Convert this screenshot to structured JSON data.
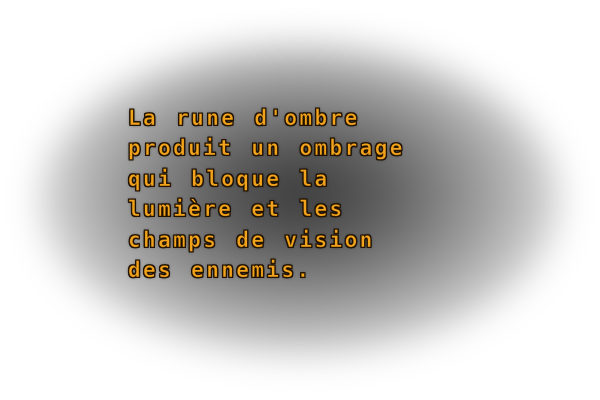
{
  "tooltip": {
    "lines": [
      "La rune d'ombre",
      "produit un ombrage",
      "qui bloque la",
      "lumière et les",
      "champs de vision",
      "des ennemis."
    ],
    "text_color": "#f2a31c",
    "outline_color": "#1a0e00",
    "shadow_color": "#000000"
  }
}
